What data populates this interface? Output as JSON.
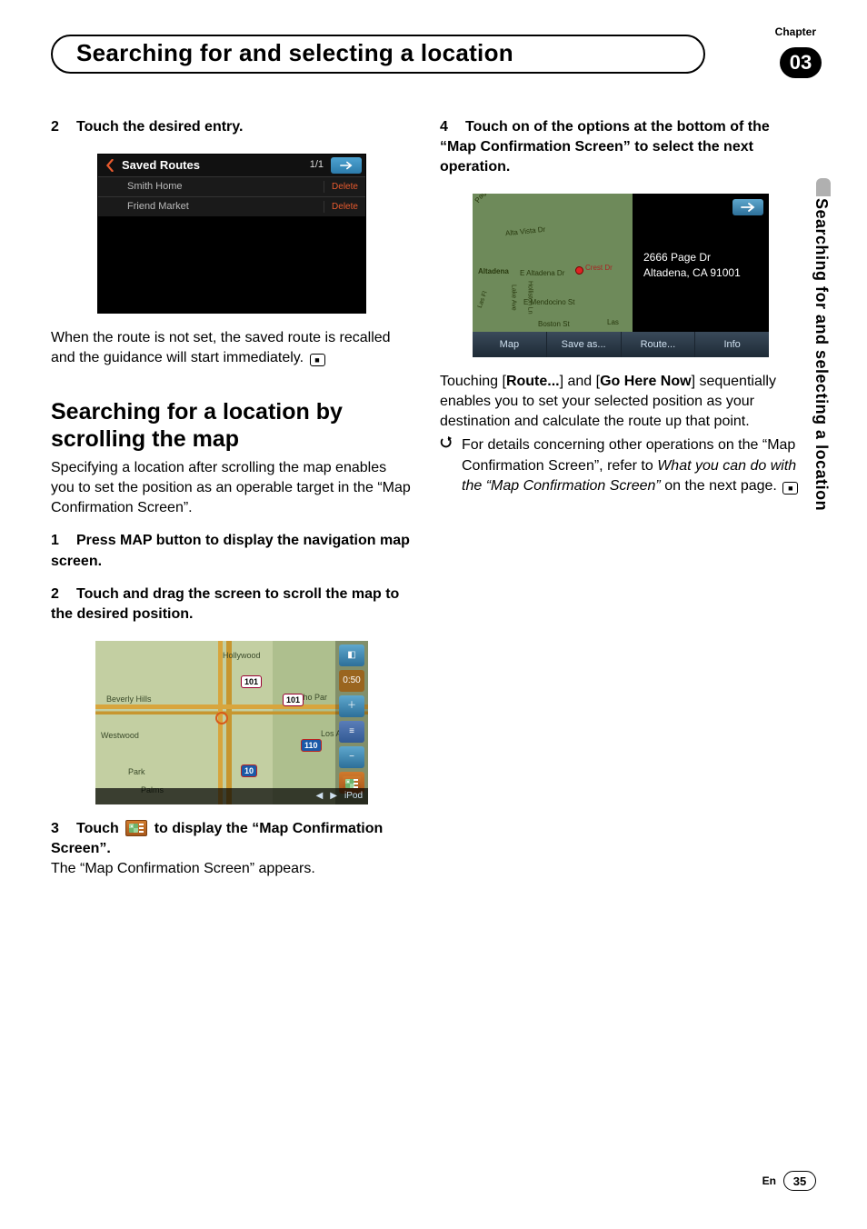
{
  "chapter_label": "Chapter",
  "chapter_number": "03",
  "page_title": "Searching for and selecting a location",
  "side_tab": "Searching for and selecting a location",
  "left": {
    "step2": {
      "num": "2",
      "text": "Touch the desired entry."
    },
    "saved_routes": {
      "title": "Saved Routes",
      "count": "1/1",
      "rows": [
        {
          "label": "Smith Home",
          "action": "Delete"
        },
        {
          "label": "Friend Market",
          "action": "Delete"
        }
      ]
    },
    "after_saved": "When the route is not set, the saved route is recalled and the guidance will start immediately.",
    "h2": "Searching for a location by scrolling the map",
    "intro": "Specifying a location after scrolling the map enables you to set the position as an operable target in the “Map Confirmation Screen”.",
    "s1": {
      "num": "1",
      "text": "Press MAP button to display the navigation map screen."
    },
    "s2": {
      "num": "2",
      "text": "Touch and drag the screen to scroll the map to the desired position."
    },
    "map_labels": {
      "hollywood": "Hollywood",
      "beverly": "Beverly Hills",
      "westwood": "Westwood",
      "palms": "Palms",
      "echo": "Echo Par",
      "losan": "Los An",
      "park": "Park",
      "shield101a": "101",
      "shield101b": "101",
      "shield110": "110",
      "shield10": "10",
      "time": "0:50",
      "ipod": "iPod"
    },
    "s3": {
      "num": "3",
      "pre": "Touch ",
      "post": " to display the “Map Confirmation Screen”."
    },
    "s3_body": "The “Map Confirmation Screen” appears."
  },
  "right": {
    "s4": {
      "num": "4",
      "text": "Touch on of the options at the bottom of the “Map Confirmation Screen” to select the next operation."
    },
    "confirm": {
      "addr1": "2666 Page Dr",
      "addr2": "Altadena, CA 91001",
      "streets": {
        "alta": "Alta Vista Dr",
        "altadena_l": "Altadena",
        "altadena_dr": "E Altadena Dr",
        "crest": "Crest Dr",
        "mendo": "E Mendocino St",
        "boston": "Boston St",
        "las": "Las",
        "holliston": "Holliston Ln",
        "lake": "Lake Ave"
      },
      "buttons": [
        "Map",
        "Save as...",
        "Route...",
        "Info"
      ]
    },
    "para_pre": "Touching [",
    "para_b1": "Route...",
    "para_mid": "] and [",
    "para_b2": "Go Here Now",
    "para_post": "] sequentially enables you to set your selected position as your destination and calculate the route up that point.",
    "bullet": {
      "l1": "For details concerning other operations on the “Map Confirmation Screen”, refer to ",
      "italic": "What you can do with the “Map Confirmation Screen”",
      "l2": " on the next page."
    }
  },
  "footer": {
    "lang": "En",
    "page": "35"
  }
}
